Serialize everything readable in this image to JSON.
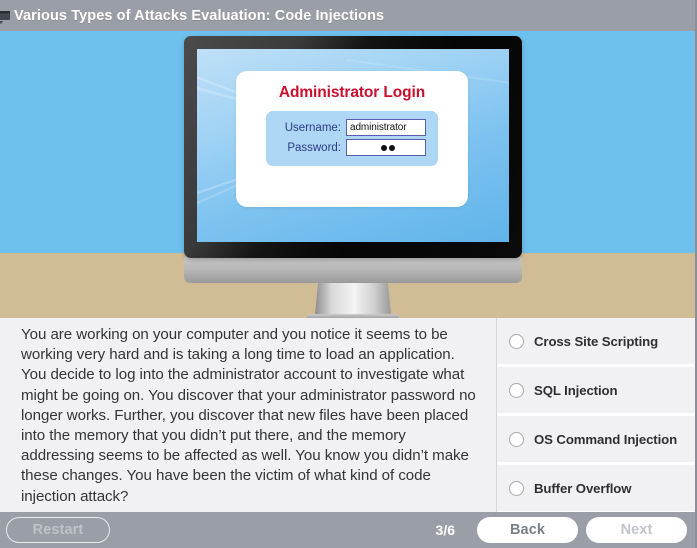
{
  "window": {
    "title": "Various Types of Attacks Evaluation: Code Injections",
    "icon": "app-window-icon",
    "titlebar_color": "#9a9ea6"
  },
  "illustration": {
    "name": "desktop-monitor-illustration",
    "sky_color": "#6ec1ec",
    "desk_color": "#d1bd95",
    "screen": {
      "login_title": "Administrator Login",
      "title_color": "#c8102e",
      "fields": [
        {
          "label": "Username:",
          "value": "administrator",
          "type": "text"
        },
        {
          "label": "Password:",
          "value": "●●",
          "type": "password",
          "dots": 2
        }
      ]
    }
  },
  "question": {
    "text": "You are working on your computer and you notice it seems to be working very hard and is taking a long time to load an application. You decide to log into the administrator account to investigate what might be going on. You discover that your administrator password no longer works. Further, you discover that new files have been placed into the memory that you didn’t put there, and the memory addressing seems to be affected as well. You know you didn’t make these changes. You have been the victim of what kind of code injection attack?"
  },
  "answers": {
    "selected": null,
    "options": [
      {
        "label": "Cross Site Scripting",
        "selected": false
      },
      {
        "label": "SQL Injection",
        "selected": false
      },
      {
        "label": "OS Command Injection",
        "selected": false
      },
      {
        "label": "Buffer Overflow",
        "selected": false
      }
    ]
  },
  "navigation": {
    "restart_label": "Restart",
    "page_counter": "3/6",
    "back_label": "Back",
    "next_label": "Next",
    "next_enabled": false,
    "bar_color": "#9a9ea6"
  }
}
